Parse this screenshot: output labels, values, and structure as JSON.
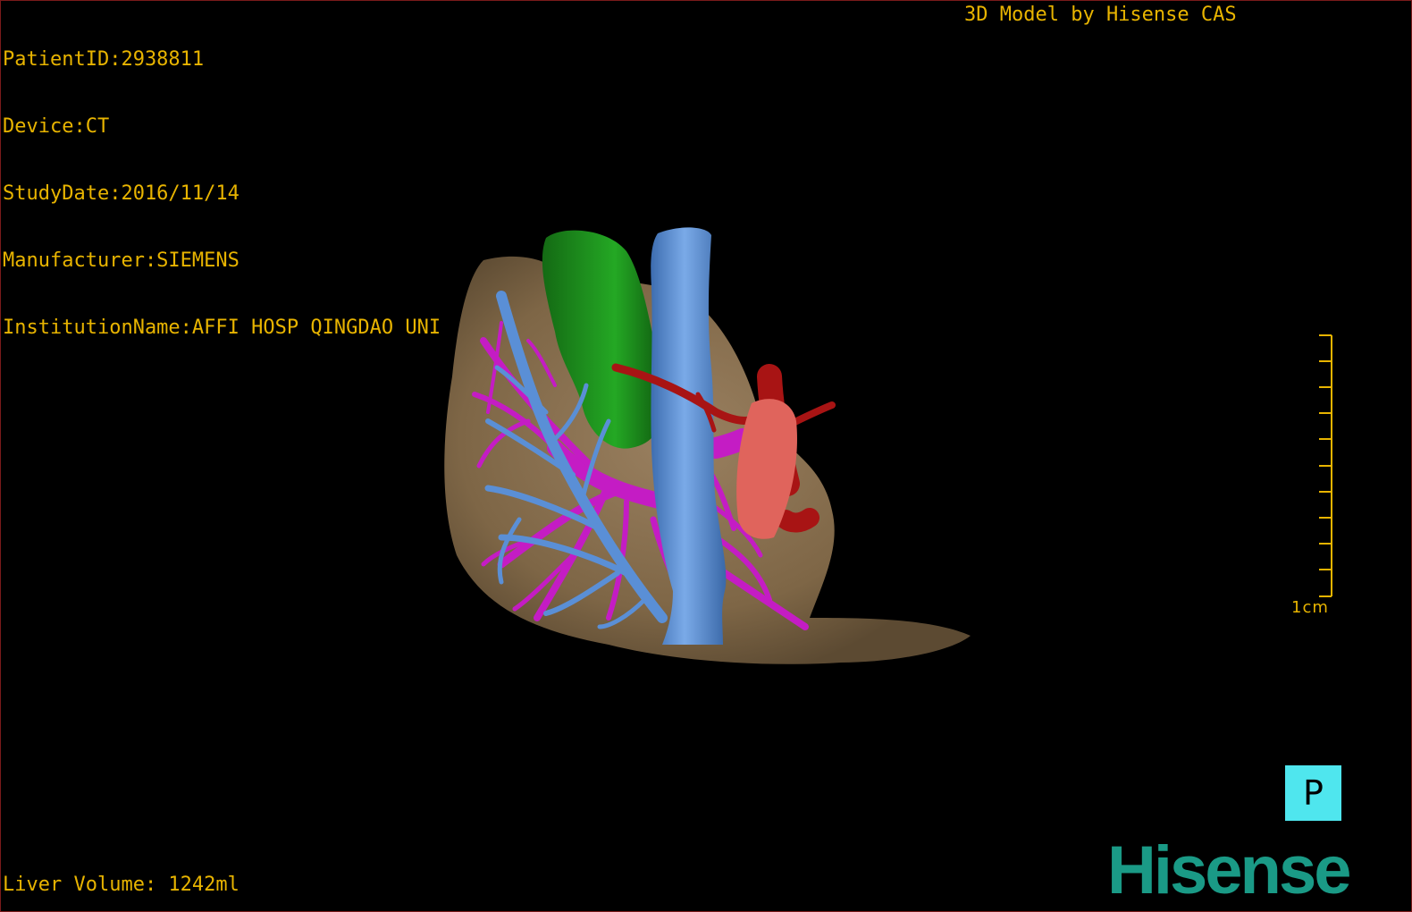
{
  "patient_info": {
    "patient_id": "PatientID:2938811",
    "device": "Device:CT",
    "study_date": "StudyDate:2016/11/14",
    "manufacturer": "Manufacturer:SIEMENS",
    "institution": "InstitutionName:AFFI HOSP QINGDAO UNI"
  },
  "model_credit": "3D Model by Hisense CAS",
  "liver_volume": "Liver Volume: 1242ml",
  "scale_bar": {
    "label": "1cm",
    "color": "#e8b400"
  },
  "orientation": {
    "label": "P",
    "color": "#4fe6ee"
  },
  "brand": {
    "name": "Hisense",
    "color": "#1a9a86"
  },
  "render_colors": {
    "liver": "#8a7252",
    "gallbladder": "#1e8e1e",
    "vena_cava": "#5a8fd6",
    "portal_vein": "#c41cc4",
    "artery": "#a81414",
    "tumor": "#e0645c"
  }
}
